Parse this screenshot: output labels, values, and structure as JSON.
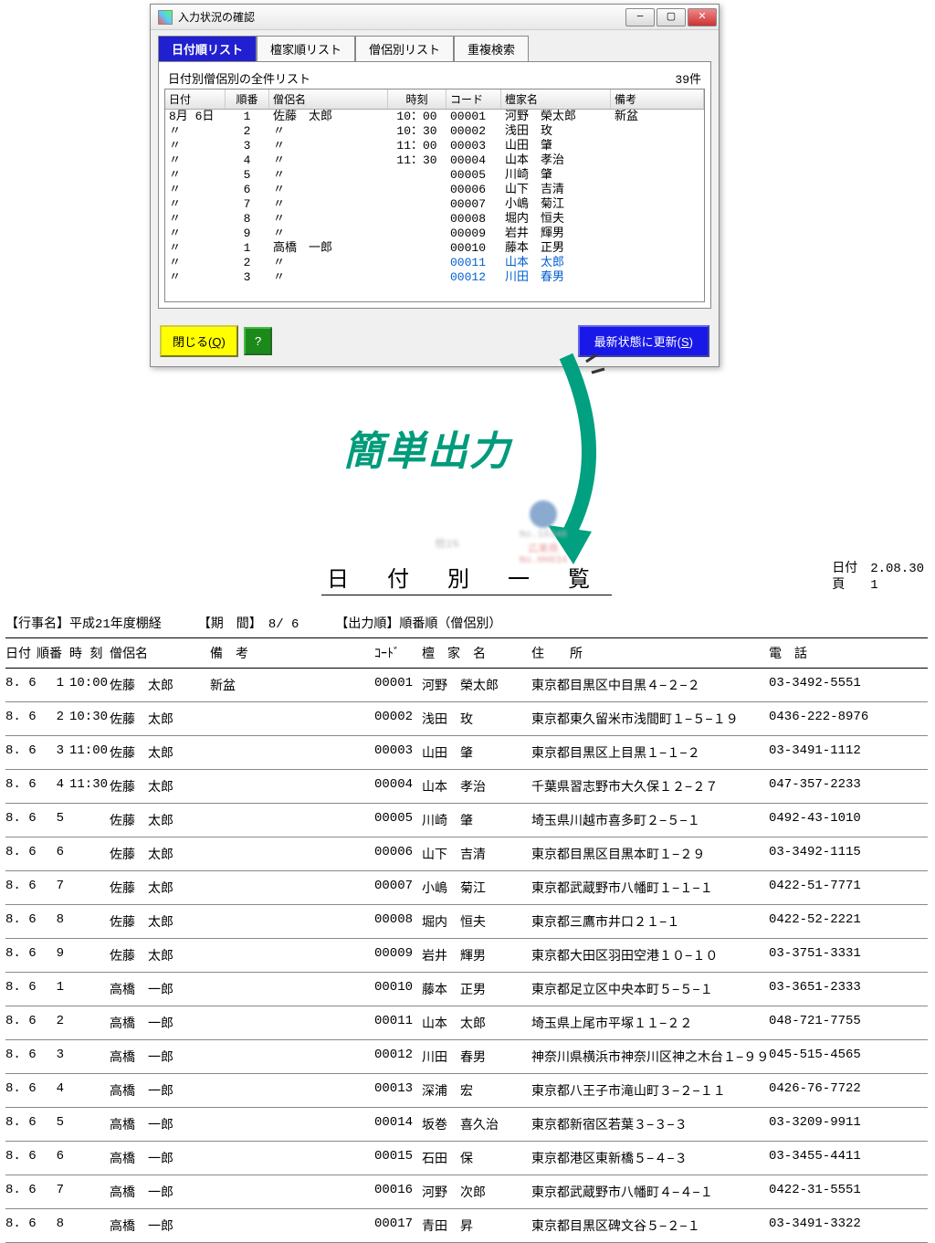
{
  "window": {
    "title": "入力状況の確認",
    "tabs": [
      "日付順リスト",
      "檀家順リスト",
      "僧侶別リスト",
      "重複検索"
    ],
    "caption": "日付別僧侶別の全件リスト",
    "count": "39件",
    "columns": [
      "日付",
      "順番",
      "僧侶名",
      "時刻",
      "コード",
      "檀家名",
      "備考"
    ],
    "rows": [
      {
        "date": "8月 6日",
        "no": "1",
        "priest": "佐藤　太郎",
        "time": "10：00",
        "code": "00001",
        "family": "河野　榮太郎",
        "note": "新盆",
        "blue": false
      },
      {
        "date": "〃",
        "no": "2",
        "priest": "〃",
        "time": "10：30",
        "code": "00002",
        "family": "浅田　玫",
        "note": "",
        "blue": false
      },
      {
        "date": "〃",
        "no": "3",
        "priest": "〃",
        "time": "11：00",
        "code": "00003",
        "family": "山田　肇",
        "note": "",
        "blue": false
      },
      {
        "date": "〃",
        "no": "4",
        "priest": "〃",
        "time": "11：30",
        "code": "00004",
        "family": "山本　孝治",
        "note": "",
        "blue": false
      },
      {
        "date": "〃",
        "no": "5",
        "priest": "〃",
        "time": "",
        "code": "00005",
        "family": "川崎　肇",
        "note": "",
        "blue": false
      },
      {
        "date": "〃",
        "no": "6",
        "priest": "〃",
        "time": "",
        "code": "00006",
        "family": "山下　吉清",
        "note": "",
        "blue": false
      },
      {
        "date": "〃",
        "no": "7",
        "priest": "〃",
        "time": "",
        "code": "00007",
        "family": "小嶋　菊江",
        "note": "",
        "blue": false
      },
      {
        "date": "〃",
        "no": "8",
        "priest": "〃",
        "time": "",
        "code": "00008",
        "family": "堀内　恒夫",
        "note": "",
        "blue": false
      },
      {
        "date": "〃",
        "no": "9",
        "priest": "〃",
        "time": "",
        "code": "00009",
        "family": "岩井　輝男",
        "note": "",
        "blue": false
      },
      {
        "date": "〃",
        "no": "1",
        "priest": "高橋　一郎",
        "time": "",
        "code": "00010",
        "family": "藤本　正男",
        "note": "",
        "blue": false
      },
      {
        "date": "〃",
        "no": "2",
        "priest": "〃",
        "time": "",
        "code": "00011",
        "family": "山本　太郎",
        "note": "",
        "blue": true
      },
      {
        "date": "〃",
        "no": "3",
        "priest": "〃",
        "time": "",
        "code": "00012",
        "family": "川田　春男",
        "note": "",
        "blue": true
      }
    ],
    "btn_close": "閉じる(Q)",
    "btn_help": "?",
    "btn_refresh": "最新状態に更新(S)"
  },
  "caption": "簡単出力",
  "blur": {
    "pct": "他1%",
    "no": "No.10346",
    "sub": "広東商No.HH034"
  },
  "report": {
    "title": "日 付 別 一 覧",
    "meta_date_label": "日付",
    "meta_date": "2.08.30",
    "meta_page_label": "頁",
    "meta_page": "1",
    "event_label": "【行事名】",
    "event": "平成21年度棚経",
    "period_label": "【期　間】",
    "period": "8/ 6",
    "order_label": "【出力順】",
    "order": "順番順（僧侶別）",
    "cols": [
      "日付",
      "順番",
      "時 刻",
      "僧侶名",
      "備　考",
      "ｺｰﾄﾞ",
      "檀　家　名",
      "住　　所",
      "電　話"
    ],
    "rows": [
      {
        "d": "8. 6",
        "n": "1",
        "t": "10:00",
        "p": "佐藤　太郎",
        "note": "新盆",
        "code": "00001",
        "fam": "河野　榮太郎",
        "addr": "東京都目黒区中目黒４−２−２",
        "tel": "03-3492-5551"
      },
      {
        "d": "8. 6",
        "n": "2",
        "t": "10:30",
        "p": "佐藤　太郎",
        "note": "",
        "code": "00002",
        "fam": "浅田　玫",
        "addr": "東京都東久留米市浅間町１−５−１９",
        "tel": "0436-222-8976"
      },
      {
        "d": "8. 6",
        "n": "3",
        "t": "11:00",
        "p": "佐藤　太郎",
        "note": "",
        "code": "00003",
        "fam": "山田　肇",
        "addr": "東京都目黒区上目黒１−１−２",
        "tel": "03-3491-1112"
      },
      {
        "d": "8. 6",
        "n": "4",
        "t": "11:30",
        "p": "佐藤　太郎",
        "note": "",
        "code": "00004",
        "fam": "山本　孝治",
        "addr": "千葉県習志野市大久保１２−２７",
        "tel": "047-357-2233"
      },
      {
        "d": "8. 6",
        "n": "5",
        "t": "",
        "p": "佐藤　太郎",
        "note": "",
        "code": "00005",
        "fam": "川崎　肇",
        "addr": "埼玉県川越市喜多町２−５−１",
        "tel": "0492-43-1010"
      },
      {
        "d": "8. 6",
        "n": "6",
        "t": "",
        "p": "佐藤　太郎",
        "note": "",
        "code": "00006",
        "fam": "山下　吉清",
        "addr": "東京都目黒区目黒本町１−２９",
        "tel": "03-3492-1115"
      },
      {
        "d": "8. 6",
        "n": "7",
        "t": "",
        "p": "佐藤　太郎",
        "note": "",
        "code": "00007",
        "fam": "小嶋　菊江",
        "addr": "東京都武蔵野市八幡町１−１−１",
        "tel": "0422-51-7771"
      },
      {
        "d": "8. 6",
        "n": "8",
        "t": "",
        "p": "佐藤　太郎",
        "note": "",
        "code": "00008",
        "fam": "堀内　恒夫",
        "addr": "東京都三鷹市井口２１−１",
        "tel": "0422-52-2221"
      },
      {
        "d": "8. 6",
        "n": "9",
        "t": "",
        "p": "佐藤　太郎",
        "note": "",
        "code": "00009",
        "fam": "岩井　輝男",
        "addr": "東京都大田区羽田空港１０−１０",
        "tel": "03-3751-3331"
      },
      {
        "d": "8. 6",
        "n": "1",
        "t": "",
        "p": "高橋　一郎",
        "note": "",
        "code": "00010",
        "fam": "藤本　正男",
        "addr": "東京都足立区中央本町５−５−１",
        "tel": "03-3651-2333"
      },
      {
        "d": "8. 6",
        "n": "2",
        "t": "",
        "p": "高橋　一郎",
        "note": "",
        "code": "00011",
        "fam": "山本　太郎",
        "addr": "埼玉県上尾市平塚１１−２２",
        "tel": "048-721-7755"
      },
      {
        "d": "8. 6",
        "n": "3",
        "t": "",
        "p": "高橋　一郎",
        "note": "",
        "code": "00012",
        "fam": "川田　春男",
        "addr": "神奈川県横浜市神奈川区神之木台１−９９",
        "tel": "045-515-4565"
      },
      {
        "d": "8. 6",
        "n": "4",
        "t": "",
        "p": "高橋　一郎",
        "note": "",
        "code": "00013",
        "fam": "深浦　宏",
        "addr": "東京都八王子市滝山町３−２−１１",
        "tel": "0426-76-7722"
      },
      {
        "d": "8. 6",
        "n": "5",
        "t": "",
        "p": "高橋　一郎",
        "note": "",
        "code": "00014",
        "fam": "坂巻　喜久治",
        "addr": "東京都新宿区若葉３−３−３",
        "tel": "03-3209-9911"
      },
      {
        "d": "8. 6",
        "n": "6",
        "t": "",
        "p": "高橋　一郎",
        "note": "",
        "code": "00015",
        "fam": "石田　保",
        "addr": "東京都港区東新橋５−４−３",
        "tel": "03-3455-4411"
      },
      {
        "d": "8. 6",
        "n": "7",
        "t": "",
        "p": "高橋　一郎",
        "note": "",
        "code": "00016",
        "fam": "河野　次郎",
        "addr": "東京都武蔵野市八幡町４−４−１",
        "tel": "0422-31-5551"
      },
      {
        "d": "8. 6",
        "n": "8",
        "t": "",
        "p": "高橋　一郎",
        "note": "",
        "code": "00017",
        "fam": "青田　昇",
        "addr": "東京都目黒区碑文谷５−２−１",
        "tel": "03-3491-3322"
      }
    ]
  }
}
